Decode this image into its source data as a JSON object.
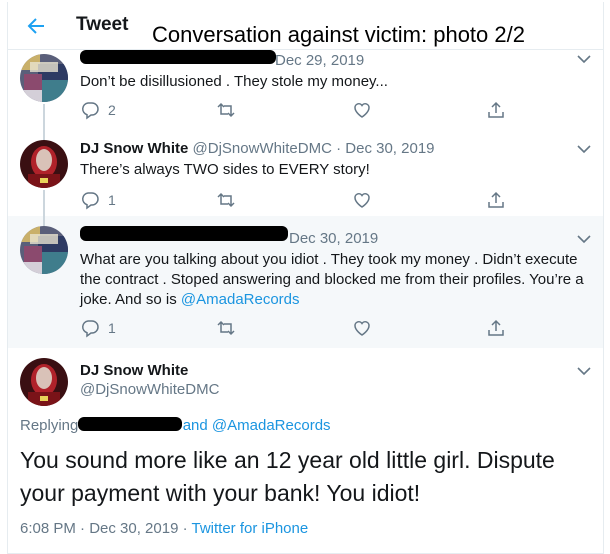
{
  "header": {
    "title": "Tweet"
  },
  "caption": "Conversation against victim: photo 2/2",
  "tweets": [
    {
      "date": "Dec 29, 2019",
      "text": "Don’t be disillusioned . They stole my money...",
      "replies": "2",
      "retweets": "",
      "likes": ""
    },
    {
      "name": "DJ Snow White",
      "handle": "@DjSnowWhiteDMC",
      "date": "Dec 30, 2019",
      "text": "There’s always TWO sides to EVERY story!",
      "replies": "1"
    },
    {
      "date": "Dec 30, 2019",
      "text_before": "What are you talking about you idiot . They took my money . Didn’t execute the contract . Stoped answering and blocked me from their profiles. You’re a joke. And so is ",
      "mention": "@AmadaRecords",
      "replies": "1"
    }
  ],
  "main_tweet": {
    "name": "DJ Snow White",
    "handle": "@DjSnowWhiteDMC",
    "replying_prefix": "Replying",
    "replying_suffix": "and ",
    "replying_mention": "@AmadaRecords",
    "text": "You sound more like an 12 year old little girl. Dispute your payment with your bank! You idiot!",
    "time": "6:08 PM · Dec 30, 2019 · ",
    "source": "Twitter for iPhone"
  },
  "colors": {
    "accent": "#1b95e0",
    "muted": "#657786",
    "border": "#e6ecf0"
  }
}
